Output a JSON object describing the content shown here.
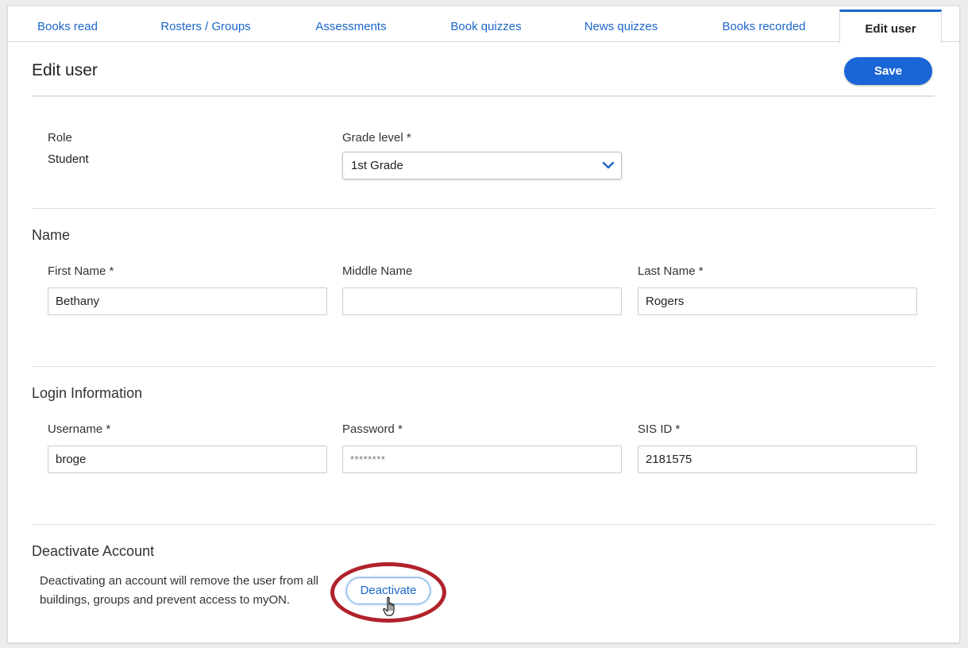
{
  "tabs": [
    {
      "label": "Books read"
    },
    {
      "label": "Rosters / Groups"
    },
    {
      "label": "Assessments"
    },
    {
      "label": "Book quizzes"
    },
    {
      "label": "News quizzes"
    },
    {
      "label": "Books recorded"
    },
    {
      "label": "Edit user",
      "active": true
    }
  ],
  "page": {
    "title": "Edit user",
    "save_label": "Save"
  },
  "role": {
    "label": "Role",
    "value": "Student"
  },
  "grade": {
    "label": "Grade level *",
    "value": "1st Grade"
  },
  "name_section": {
    "title": "Name",
    "first": {
      "label": "First Name *",
      "value": "Bethany"
    },
    "middle": {
      "label": "Middle Name",
      "value": ""
    },
    "last": {
      "label": "Last Name *",
      "value": "Rogers"
    }
  },
  "login_section": {
    "title": "Login Information",
    "username": {
      "label": "Username *",
      "value": "broge"
    },
    "password": {
      "label": "Password *",
      "value": "********"
    },
    "sis": {
      "label": "SIS ID *",
      "value": "2181575"
    }
  },
  "deactivate_section": {
    "title": "Deactivate Account",
    "description": "Deactivating an account will remove the user from all buildings, groups and prevent access to myON.",
    "button_label": "Deactivate"
  },
  "colors": {
    "accent": "#1b66d6",
    "highlight_ring": "#b1222a"
  },
  "icons": {
    "select_arrow": "chevron-down-icon",
    "cursor": "hand-pointer-icon"
  }
}
